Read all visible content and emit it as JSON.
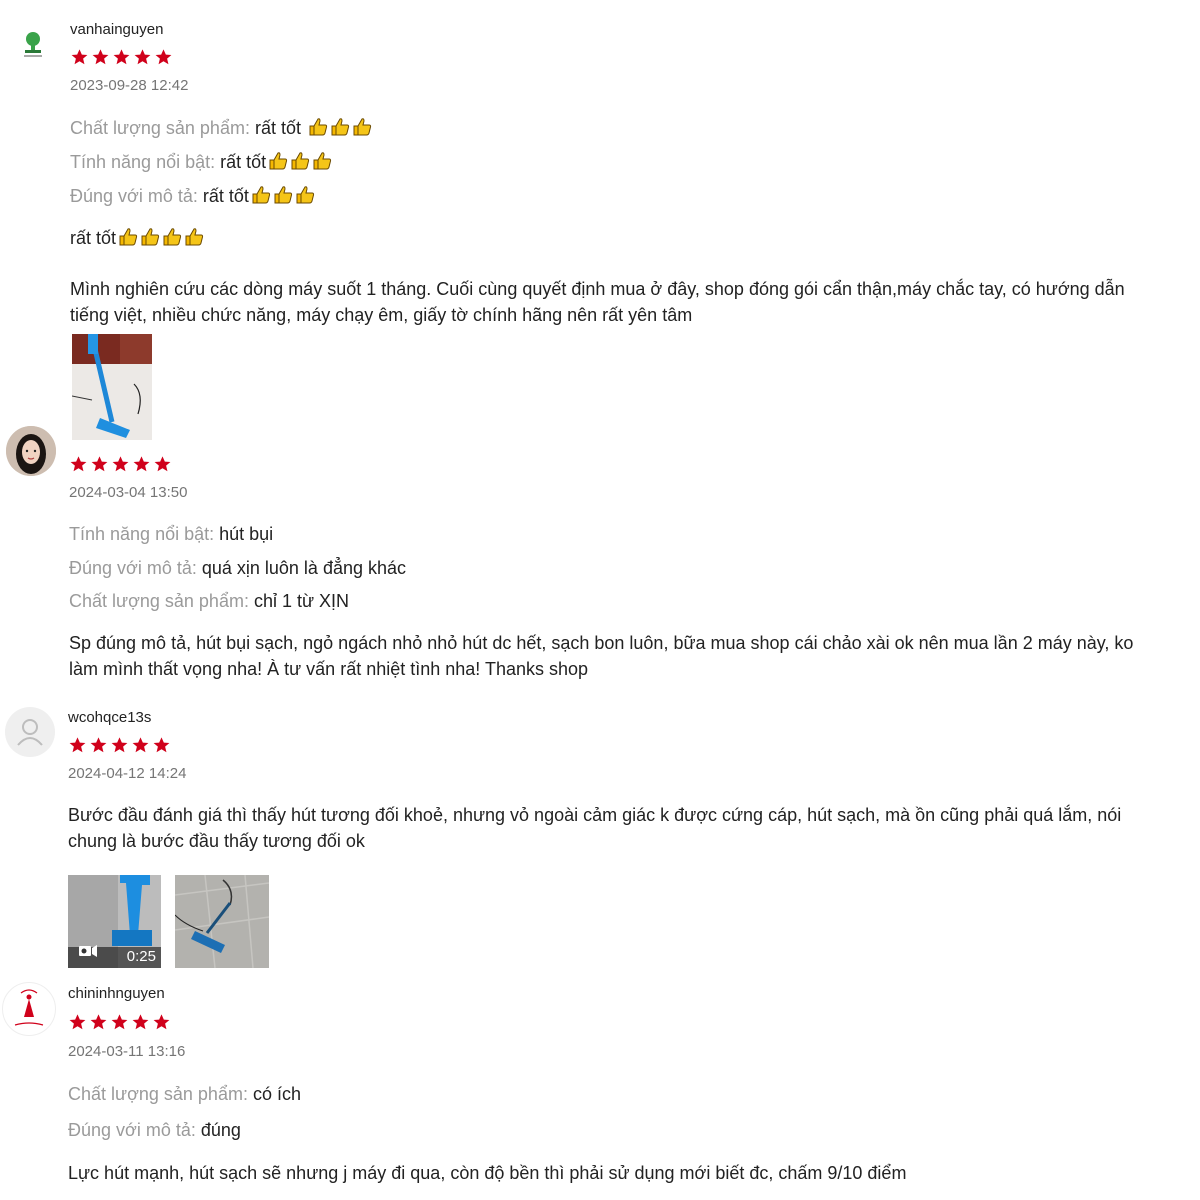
{
  "reviews": [
    {
      "username": "vanhainguyen",
      "rating": 5,
      "date": "2023-09-28 12:42",
      "attributes": [
        {
          "key": "Chất lượng sản phẩm:",
          "value": " rất tốt ",
          "thumbs": 3
        },
        {
          "key": "Tính năng nổi bật:",
          "value": " rất tốt",
          "thumbs": 3
        },
        {
          "key": "Đúng với mô tả:",
          "value": " rất tốt",
          "thumbs": 3
        }
      ],
      "short_comment": "rất tốt",
      "short_thumbs": 4,
      "comment": "Mình nghiên cứu các dòng máy suốt 1 tháng. Cuối cùng quyết định mua ở đây, shop đóng gói cẩn thận,máy chắc tay, có hướng dẫn tiếng việt, nhiều chức năng, máy chạy êm, giấy tờ chính hãng nên rất yên tâm"
    },
    {
      "username": "",
      "rating": 5,
      "date": "2024-03-04 13:50",
      "attributes": [
        {
          "key": "Tính năng nổi bật:",
          "value": " hút bụi"
        },
        {
          "key": "Đúng với mô tả:",
          "value": " quá xịn luôn là đẳng khác"
        },
        {
          "key": "Chất lượng sản phẩm:",
          "value": " chỉ 1 từ XỊN"
        }
      ],
      "comment": "Sp đúng mô tả, hút bụi sạch, ngỏ ngách nhỏ nhỏ hút dc hết, sạch bon luôn, bữa mua shop cái chảo xài ok nên mua lần 2 máy này, ko làm mình thất vọng nha! À tư vấn rất nhiệt tình nha! Thanks shop"
    },
    {
      "username": "wcohqce13s",
      "rating": 5,
      "date": "2024-04-12 14:24",
      "comment": "Bước đầu đánh giá thì thấy hút tương đối khoẻ, nhưng vỏ ngoài cảm giác k được cứng cáp, hút sạch, mà ồn cũng phải quá lắm, nói chung là bước đầu thấy tương đối ok",
      "video_duration": "0:25"
    },
    {
      "username": "chininhnguyen",
      "rating": 5,
      "date": "2024-03-11 13:16",
      "attributes": [
        {
          "key": "Chất lượng sản phẩm:",
          "value": " có ích"
        },
        {
          "key": "Đúng với mô tả:",
          "value": " đúng"
        }
      ],
      "comment": "Lực hút mạnh, hút sạch sẽ nhưng j máy đi qua, còn độ bền thì phải sử dụng mới biết đc, chấm 9/10 điểm"
    }
  ],
  "colors": {
    "star": "#d0011b",
    "label": "#9a9a9a",
    "date": "#757575",
    "thumb": "#f5b800"
  }
}
